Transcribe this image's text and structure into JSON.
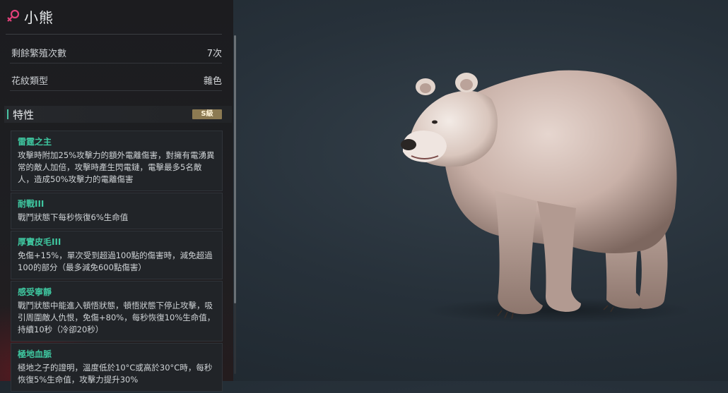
{
  "pet": {
    "name": "小熊",
    "gender_icon": "female-symbol-icon"
  },
  "stats": [
    {
      "label": "剩餘繁殖次數",
      "value": "7次"
    },
    {
      "label": "花紋類型",
      "value": "雜色"
    }
  ],
  "traits_section": {
    "title": "特性",
    "grade": "S級"
  },
  "traits": [
    {
      "name": "雷霆之主",
      "desc": "攻擊時附加25%攻擊力的額外電離傷害，對擁有電湧異常的敵人加倍，攻擊時產生閃電鏈，電擊最多5名敵人，造成50%攻擊力的電離傷害"
    },
    {
      "name": "耐戰III",
      "desc": "戰鬥狀態下每秒恢復6%生命值"
    },
    {
      "name": "厚實皮毛III",
      "desc": "免傷+15%，單次受到超過100點的傷害時，減免超過100的部分（最多減免600點傷害）"
    },
    {
      "name": "感受寧靜",
      "desc": "戰鬥狀態中能進入頓悟狀態，頓悟狀態下停止攻擊，吸引周圍敵人仇恨，免傷+80%，每秒恢復10%生命值，持續10秒（冷卻20秒）"
    },
    {
      "name": "極地血脈",
      "desc": "極地之子的證明，溫度低於10°C或高於30°C時，每秒恢復5%生命值，攻擊力提升30%"
    }
  ],
  "colors": {
    "accent": "#49c4a3",
    "trait_name": "#3fc7a0",
    "gender": "#e0407a",
    "grade_badge": "#8c7a52"
  }
}
